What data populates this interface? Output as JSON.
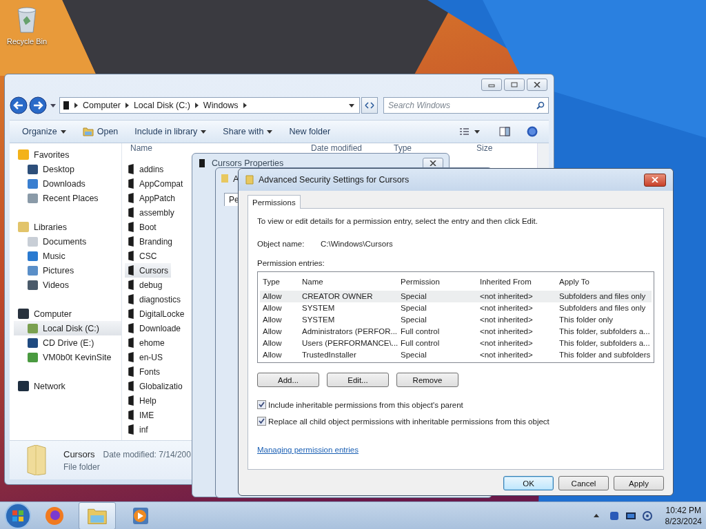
{
  "desktop": {
    "icons": [
      {
        "label": "Recycle Bin"
      }
    ]
  },
  "explorer": {
    "address": [
      "Computer",
      "Local Disk (C:)",
      "Windows"
    ],
    "search": {
      "placeholder": "Search Windows"
    },
    "toolbar": [
      {
        "label": "Organize",
        "dropdown": true,
        "kind": "menu"
      },
      {
        "label": "Open",
        "dropdown": false,
        "kind": "open"
      },
      {
        "label": "Include in library",
        "dropdown": true,
        "kind": "menu"
      },
      {
        "label": "Share with",
        "dropdown": true,
        "kind": "menu"
      },
      {
        "label": "New folder",
        "dropdown": false,
        "kind": "menu"
      }
    ],
    "nav": [
      {
        "label": "Favorites",
        "kind": "star",
        "children": [
          {
            "label": "Desktop",
            "kind": "desktop",
            "selected": false
          },
          {
            "label": "Downloads",
            "kind": "downloads",
            "selected": false
          },
          {
            "label": "Recent Places",
            "kind": "recent",
            "selected": false
          }
        ]
      },
      {
        "label": "Libraries",
        "kind": "library",
        "children": [
          {
            "label": "Documents",
            "kind": "documents",
            "selected": false
          },
          {
            "label": "Music",
            "kind": "music",
            "selected": false
          },
          {
            "label": "Pictures",
            "kind": "pictures",
            "selected": false
          },
          {
            "label": "Videos",
            "kind": "videos",
            "selected": false
          }
        ]
      },
      {
        "label": "Computer",
        "kind": "computer",
        "children": [
          {
            "label": "Local Disk (C:)",
            "kind": "disk",
            "selected": true
          },
          {
            "label": "CD Drive (E:)",
            "kind": "cd",
            "selected": false
          },
          {
            "label": "VM0b0t KevinSite",
            "kind": "share",
            "selected": false
          }
        ]
      },
      {
        "label": "Network",
        "kind": "network"
      }
    ],
    "columns": [
      "Name",
      "Date modified",
      "Type",
      "Size"
    ],
    "files": [
      {
        "name": "addins",
        "selected": false
      },
      {
        "name": "AppCompat",
        "selected": false
      },
      {
        "name": "AppPatch",
        "selected": false
      },
      {
        "name": "assembly",
        "selected": false
      },
      {
        "name": "Boot",
        "selected": false
      },
      {
        "name": "Branding",
        "selected": false
      },
      {
        "name": "CSC",
        "selected": false
      },
      {
        "name": "Cursors",
        "selected": true
      },
      {
        "name": "debug",
        "selected": false
      },
      {
        "name": "diagnostics",
        "selected": false
      },
      {
        "name": "DigitalLocke",
        "selected": false
      },
      {
        "name": "Downloade",
        "selected": false
      },
      {
        "name": "ehome",
        "selected": false
      },
      {
        "name": "en-US",
        "selected": false
      },
      {
        "name": "Fonts",
        "selected": false
      },
      {
        "name": "Globalizatio",
        "selected": false
      },
      {
        "name": "Help",
        "selected": false
      },
      {
        "name": "IME",
        "selected": false
      },
      {
        "name": "inf",
        "selected": false
      }
    ],
    "details": {
      "name": "Cursors",
      "date": "Date modified: 7/14/200",
      "type": "File folder"
    }
  },
  "properties_window": {
    "title": "Cursors Properties"
  },
  "middle_dialog": {
    "title": "A",
    "tab": "Pe"
  },
  "advanced": {
    "title": "Advanced Security Settings for Cursors",
    "tabs": [
      {
        "label": "Permissions",
        "selected": true
      }
    ],
    "intro": "To view or edit details for a permission entry, select the entry and then click Edit.",
    "object_label": "Object name:",
    "object_value": "C:\\Windows\\Cursors",
    "entries_label": "Permission entries:",
    "columns": [
      "Type",
      "Name",
      "Permission",
      "Inherited From",
      "Apply To"
    ],
    "rows": [
      {
        "type": "Allow",
        "name": "CREATOR OWNER",
        "permission": "Special",
        "inherited": "<not inherited>",
        "apply_to": "Subfolders and files only",
        "selected": true
      },
      {
        "type": "Allow",
        "name": "SYSTEM",
        "permission": "Special",
        "inherited": "<not inherited>",
        "apply_to": "Subfolders and files only",
        "selected": false
      },
      {
        "type": "Allow",
        "name": "SYSTEM",
        "permission": "Special",
        "inherited": "<not inherited>",
        "apply_to": "This folder only",
        "selected": false
      },
      {
        "type": "Allow",
        "name": "Administrators (PERFOR...",
        "permission": "Full control",
        "inherited": "<not inherited>",
        "apply_to": "This folder, subfolders a...",
        "selected": false
      },
      {
        "type": "Allow",
        "name": "Users (PERFORMANCE\\...",
        "permission": "Full control",
        "inherited": "<not inherited>",
        "apply_to": "This folder, subfolders a...",
        "selected": false
      },
      {
        "type": "Allow",
        "name": "TrustedInstaller",
        "permission": "Special",
        "inherited": "<not inherited>",
        "apply_to": "This folder and subfolders",
        "selected": false
      }
    ],
    "buttons": [
      "Add...",
      "Edit...",
      "Remove"
    ],
    "options": [
      {
        "label": "Include inheritable permissions from this object's parent",
        "checked": true
      },
      {
        "label": "Replace all child object permissions with inheritable permissions from this object",
        "checked": true
      }
    ],
    "link": "Managing permission entries",
    "footer_buttons": [
      {
        "label": "OK",
        "default": true
      },
      {
        "label": "Cancel",
        "default": false
      },
      {
        "label": "Apply",
        "default": false
      }
    ]
  },
  "taskbar": {
    "apps": [
      {
        "kind": "firefox",
        "active": false
      },
      {
        "kind": "explorer",
        "active": true
      },
      {
        "kind": "media",
        "active": false
      }
    ],
    "time": "10:42 PM",
    "date": "8/23/2024"
  }
}
